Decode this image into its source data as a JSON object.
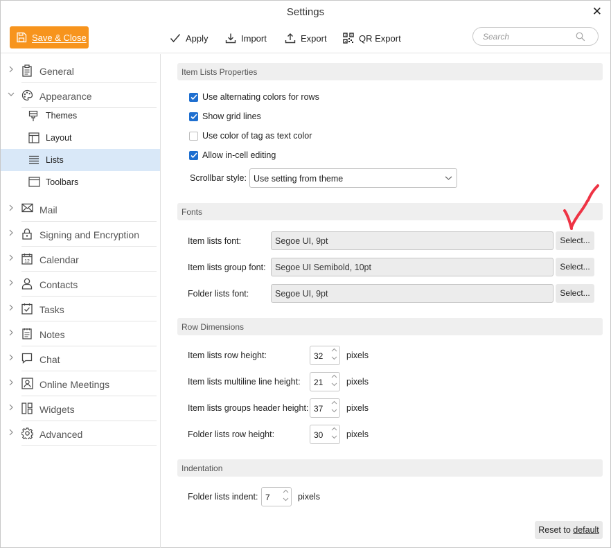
{
  "window": {
    "title": "Settings",
    "close_glyph": "✕"
  },
  "toolbar": {
    "save_close": "Save & Close",
    "apply": "Apply",
    "import": "Import",
    "export": "Export",
    "qr_export": "QR Export",
    "search_placeholder": "Search",
    "accent_color": "#f7941d"
  },
  "sidebar": {
    "items": [
      {
        "label": "General",
        "icon": "clipboard-icon"
      },
      {
        "label": "Appearance",
        "icon": "palette-icon",
        "expanded": true,
        "children": [
          {
            "label": "Themes",
            "icon": "brush-icon"
          },
          {
            "label": "Layout",
            "icon": "layout-icon"
          },
          {
            "label": "Lists",
            "icon": "list-icon",
            "selected": true
          },
          {
            "label": "Toolbars",
            "icon": "toolbar-icon"
          }
        ]
      },
      {
        "label": "Mail",
        "icon": "mail-icon"
      },
      {
        "label": "Signing and Encryption",
        "icon": "lock-icon"
      },
      {
        "label": "Calendar",
        "icon": "calendar-icon",
        "calendar_day": "12"
      },
      {
        "label": "Contacts",
        "icon": "person-icon"
      },
      {
        "label": "Tasks",
        "icon": "tasks-icon"
      },
      {
        "label": "Notes",
        "icon": "notes-icon"
      },
      {
        "label": "Chat",
        "icon": "chat-icon"
      },
      {
        "label": "Online Meetings",
        "icon": "meeting-icon"
      },
      {
        "label": "Widgets",
        "icon": "widgets-icon"
      },
      {
        "label": "Advanced",
        "icon": "gear-icon"
      }
    ]
  },
  "item_lists": {
    "header": "Item Lists Properties",
    "checkboxes": [
      {
        "label": "Use alternating colors for rows",
        "checked": true
      },
      {
        "label": "Show grid lines",
        "checked": true
      },
      {
        "label": "Use color of tag as text color",
        "checked": false
      },
      {
        "label": "Allow in-cell editing",
        "checked": true
      }
    ],
    "scrollbar_label": "Scrollbar style:",
    "scrollbar_value": "Use setting from theme"
  },
  "fonts": {
    "header": "Fonts",
    "rows": [
      {
        "label": "Item lists font:",
        "value": "Segoe UI, 9pt",
        "button": "Select..."
      },
      {
        "label": "Item lists group font:",
        "value": "Segoe UI Semibold, 10pt",
        "button": "Select..."
      },
      {
        "label": "Folder lists font:",
        "value": "Segoe UI, 9pt",
        "button": "Select..."
      }
    ]
  },
  "row_dimensions": {
    "header": "Row Dimensions",
    "unit": "pixels",
    "rows": [
      {
        "label": "Item lists row height:",
        "value": "32"
      },
      {
        "label": "Item lists multiline line height:",
        "value": "21"
      },
      {
        "label": "Item lists groups header height:",
        "value": "37"
      },
      {
        "label": "Folder lists row height:",
        "value": "30"
      }
    ]
  },
  "indentation": {
    "header": "Indentation",
    "label": "Folder lists indent:",
    "value": "7",
    "unit": "pixels"
  },
  "reset": {
    "prefix": "Reset to ",
    "underlined": "default"
  },
  "annotation_color": "#ee3344"
}
